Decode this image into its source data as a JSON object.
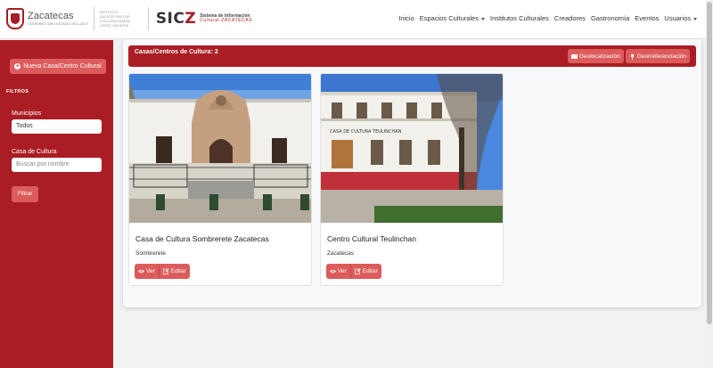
{
  "header": {
    "state_name": "Zacatecas",
    "state_subtitle": "GOBIERNO DEL ESTADO 2021-2027",
    "secretaria": "INSTITUTO ZACATECANO DE CULTURA RAMÓN LÓPEZ VELARDE",
    "sicz_logo": "SICZ",
    "sicz_line1": "Sistema de Información",
    "sicz_line2": "Cultural ZACATECAS",
    "nav": [
      "Inicio",
      "Espacios Culturales",
      "Institutos Culturales",
      "Creadores",
      "Gastronomía",
      "Eventos",
      "Usuarios"
    ]
  },
  "sidebar": {
    "new_button": "Nueva Casa/Centro Cultural",
    "filters_heading": "FILTROS",
    "municipio_label": "Municipios",
    "municipio_value": "Todos",
    "casa_label": "Casa de Cultura",
    "casa_placeholder": "Buscar por nombre",
    "filter_button": "Filtrar"
  },
  "panel": {
    "title": "Casas/Centros de Cultura: 2",
    "geo_button": "Geolocalización",
    "georef_button": "Georreferenciación"
  },
  "cards": [
    {
      "title": "Casa de Cultura Sombrerete Zacatecas",
      "municipio": "Sombrerete",
      "view": "Ver",
      "edit": "Editar"
    },
    {
      "title": "Centro Cultural Teulinchan",
      "municipio": "Zacatecas",
      "view": "Ver",
      "edit": "Editar",
      "sign": "CASA DE CULTURA TEULINCHAN"
    }
  ],
  "colors": {
    "brand": "#ab1d24",
    "button": "#dc5c5c"
  }
}
